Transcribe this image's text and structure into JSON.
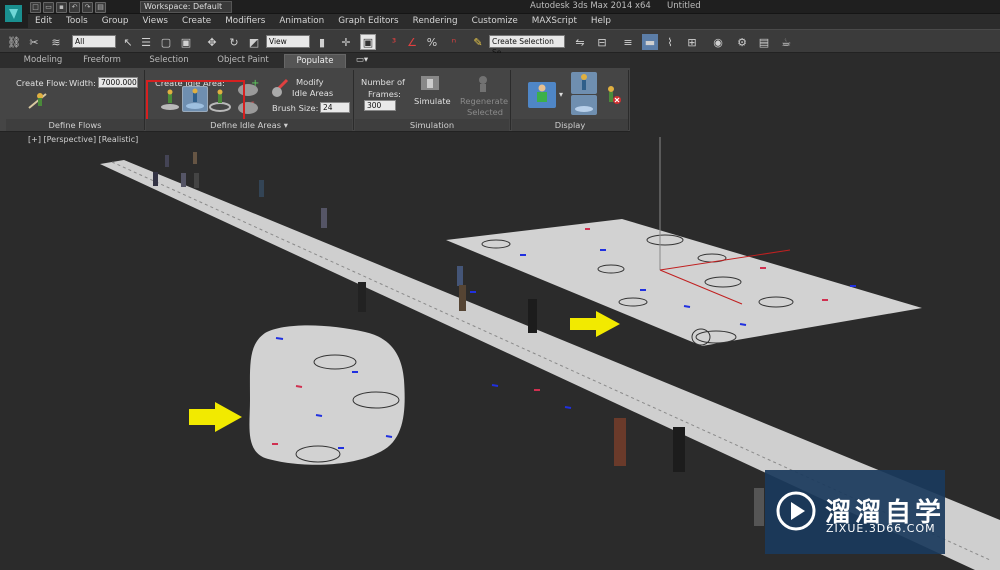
{
  "window": {
    "app_title": "Autodesk 3ds Max  2014 x64",
    "doc_title": "Untitled",
    "workspace": "Workspace: Default"
  },
  "menu": [
    "Edit",
    "Tools",
    "Group",
    "Views",
    "Create",
    "Modifiers",
    "Animation",
    "Graph Editors",
    "Rendering",
    "Customize",
    "MAXScript",
    "Help"
  ],
  "toolbar": {
    "filter_value": "All",
    "view_value": "View",
    "selection_set_placeholder": "Create Selection Se"
  },
  "ribbon_tabs": [
    "Modeling",
    "Freeform",
    "Selection",
    "Object Paint",
    "Populate"
  ],
  "active_tab": "Populate",
  "ribbon": {
    "create_flow": "Create Flow:",
    "width_label": "Width:",
    "width_value": "7000.000",
    "create_idle_area": "Create Idle Area:",
    "modify": "Modify",
    "idle_areas": "Idle Areas",
    "brush_size_label": "Brush Size:",
    "brush_size_value": "24",
    "number_of": "Number of",
    "frames_label": "Frames:",
    "frames_value": "300",
    "simulate": "Simulate",
    "regenerate": "Regenerate",
    "selected": "Selected",
    "footers": {
      "define_flows": "Define Flows",
      "define_idle_areas": "Define Idle Areas",
      "simulation": "Simulation",
      "display": "Display"
    }
  },
  "viewport": {
    "label": "[+] [Perspective] [Realistic]"
  },
  "watermark": {
    "cn": "溜溜自学",
    "url": "ZIXUE.3D66.COM"
  },
  "colors": {
    "accent_yellow": "#f2ea00",
    "highlight_red": "#d62020",
    "ground": "#cfcfcf",
    "bg": "#2b2b2b"
  }
}
